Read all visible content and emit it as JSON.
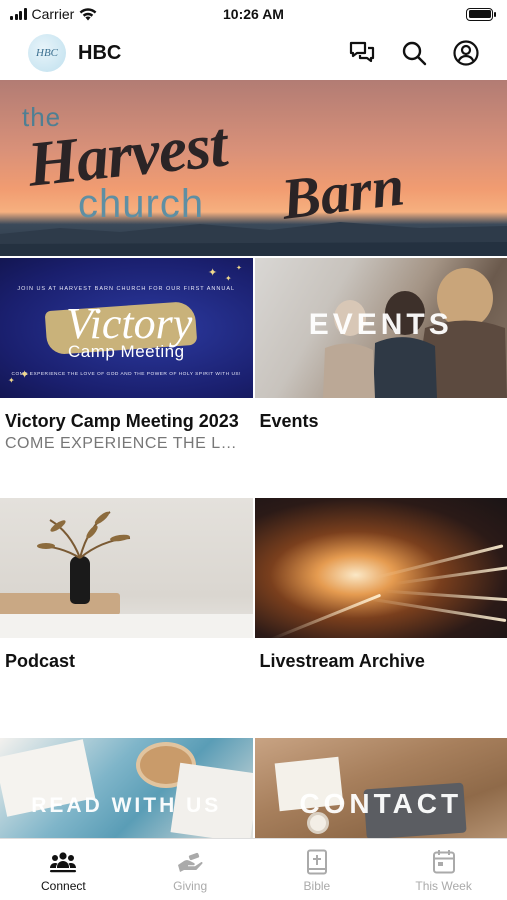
{
  "status_bar": {
    "carrier": "Carrier",
    "time": "10:26 AM"
  },
  "header": {
    "logo_text": "HBC",
    "title": "HBC",
    "icons": [
      "messages-icon",
      "search-icon",
      "account-icon"
    ]
  },
  "banner": {
    "line1": "the",
    "line2": "Harvest",
    "line3": "church",
    "line4": "Barn"
  },
  "tiles": [
    {
      "title": "Victory Camp Meeting 2023",
      "subtitle": "COME EXPERIENCE THE LOV...",
      "image": {
        "top_line": "JOIN US AT HARVEST BARN CHURCH FOR OUR FIRST ANNUAL",
        "script": "Victory",
        "heading": "Camp Meeting",
        "bottom_line": "COME EXPERIENCE THE LOVE OF GOD AND THE POWER OF HOLY SPIRIT WITH US!"
      }
    },
    {
      "title": "Events",
      "subtitle": "",
      "image": {
        "overlay": "EVENTS"
      }
    },
    {
      "title": "Podcast",
      "subtitle": ""
    },
    {
      "title": "Livestream Archive",
      "subtitle": ""
    },
    {
      "title": "",
      "subtitle": "",
      "image": {
        "overlay": "READ WITH US"
      }
    },
    {
      "title": "",
      "subtitle": "",
      "image": {
        "overlay": "CONTACT"
      }
    }
  ],
  "tabbar": {
    "items": [
      {
        "label": "Connect",
        "icon": "people-icon",
        "active": true
      },
      {
        "label": "Giving",
        "icon": "giving-hand-icon",
        "active": false
      },
      {
        "label": "Bible",
        "icon": "bible-icon",
        "active": false
      },
      {
        "label": "This Week",
        "icon": "calendar-icon",
        "active": false
      }
    ]
  },
  "colors": {
    "active_tab": "#111111",
    "inactive_tab": "#aaaaaa",
    "subtitle": "#777777"
  }
}
